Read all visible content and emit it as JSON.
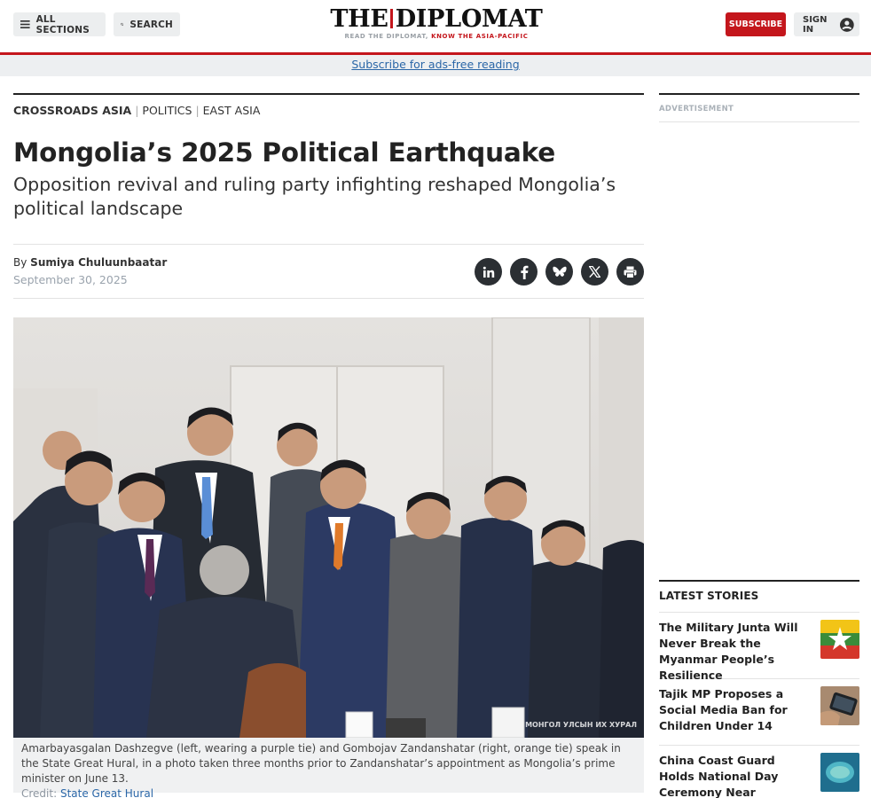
{
  "header": {
    "all_sections_label": "ALL SECTIONS",
    "search_label": "SEARCH",
    "logo_title_left": "THE",
    "logo_title_right": "DIPLOMAT",
    "logo_tagline_gray": "READ THE DIPLOMAT,",
    "logo_tagline_red": "KNOW THE ASIA-PACIFIC",
    "subscribe_label": "SUBSCRIBE",
    "signin_label": "SIGN IN",
    "adfree_link": "Subscribe for ads-free reading"
  },
  "article": {
    "categories": [
      {
        "label": "CROSSROADS ASIA"
      },
      {
        "label": "POLITICS"
      },
      {
        "label": "EAST ASIA"
      }
    ],
    "title": "Mongolia’s 2025 Political Earthquake",
    "subtitle": "Opposition revival and ruling party infighting reshaped Mongolia’s political landscape",
    "by_prefix": "By",
    "author": "Sumiya Chuluunbaatar",
    "date": "September 30, 2025",
    "share_icons": [
      "linkedin-icon",
      "facebook-icon",
      "bluesky-icon",
      "x-icon",
      "print-icon"
    ],
    "photo_watermark": "МОНГОЛ УЛСЫН ИХ ХУРАЛ",
    "caption": "Amarbayasgalan Dashzegve (left, wearing a purple tie) and Gombojav Zandanshatar (right, orange tie) speak in the State Great Hural, in a photo taken three months prior to Zandanshatar’s appointment as Mongolia’s prime minister on June 13.",
    "credit_label": "Credit:",
    "credit_source": "State Great Hural"
  },
  "sidebar": {
    "ad_label": "ADVERTISEMENT",
    "latest_heading": "LATEST STORIES",
    "stories": [
      {
        "title": "The Military Junta Will Never Break the Myanmar People’s Resilience"
      },
      {
        "title": "Tajik MP Proposes a Social Media Ban for Children Under 14"
      },
      {
        "title": "China Coast Guard Holds National Day Ceremony Near Disputed South China"
      }
    ]
  },
  "colors": {
    "brand_red": "#c4161c",
    "link_blue": "#2a66a7",
    "share_circle": "#2b2f33"
  }
}
